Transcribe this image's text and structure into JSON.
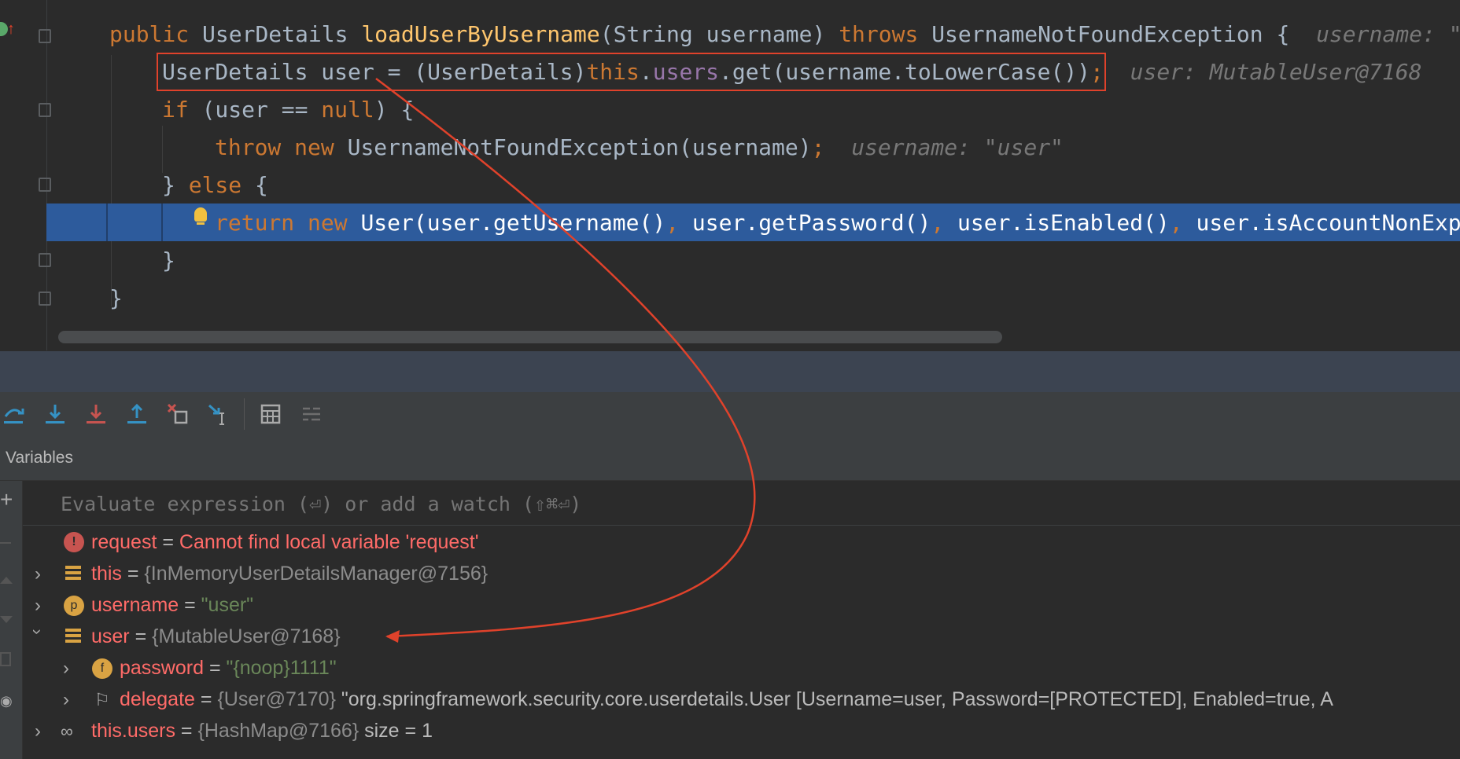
{
  "editor": {
    "line1": {
      "kw1": "public",
      "type": "UserDetails",
      "fn": "loadUserByUsername",
      "params": "(String username)",
      "kw2": "throws",
      "exc": "UsernameNotFoundException {",
      "hint": "username: \""
    },
    "line2": {
      "pre": "UserDetails user = (UserDetails)",
      "kw": "this",
      "dot": ".",
      "fld": "users",
      "post": ".get(username.toLowerCase())",
      "semi": ";",
      "hint": "user: MutableUser@7168"
    },
    "line3": {
      "kw": "if",
      "pre": " (user == ",
      "kw2": "null",
      "post": ") {"
    },
    "line4": {
      "kw": "throw",
      "kw2": "new",
      "post": "UsernameNotFoundException(username)",
      "semi": ";",
      "hint": "username: \"user\""
    },
    "line5": {
      "pre": "} ",
      "kw": "else",
      "post": " {"
    },
    "line6": {
      "kw": "return",
      "kw2": "new",
      "post": "User(user.getUsername()",
      "c1": ",",
      "p2": " user.getPassword()",
      "c2": ",",
      "p3": " user.isEnabled()",
      "c3": ",",
      "p4": " user.isAccountNonExp"
    },
    "line7": {
      "text": "}"
    },
    "line8": {
      "text": "}"
    }
  },
  "toolbar": {
    "icons": [
      "step-over-icon",
      "step-into-icon",
      "force-step-into-icon",
      "step-out-icon",
      "drop-frame-icon",
      "run-to-cursor-icon",
      "evaluate-expression-icon",
      "trace-stream-icon"
    ]
  },
  "variables": {
    "title": "Variables",
    "eval_placeholder": "Evaluate expression (⏎) or add a watch (⇧⌘⏎)",
    "rows": [
      {
        "name": "request",
        "eq": " = ",
        "value": "Cannot find local variable 'request'"
      },
      {
        "name": "this",
        "eq": " = ",
        "value": "{InMemoryUserDetailsManager@7156}"
      },
      {
        "name": "username",
        "eq": " = ",
        "value": "\"user\""
      },
      {
        "name": "user",
        "eq": " = ",
        "value": "{MutableUser@7168}"
      },
      {
        "name": "password",
        "eq": " = ",
        "value": "\"{noop}1111\""
      },
      {
        "name": "delegate",
        "eq": " = ",
        "value": "{User@7170}",
        "extra": " \"org.springframework.security.core.userdetails.User [Username=user, Password=[PROTECTED], Enabled=true, A"
      },
      {
        "name": "this.users",
        "eq": " = ",
        "value": "{HashMap@7166}",
        "extra": "  size = 1"
      }
    ]
  },
  "colors": {
    "accent_red": "#e0422b",
    "exec_line": "#2d5b9c"
  }
}
